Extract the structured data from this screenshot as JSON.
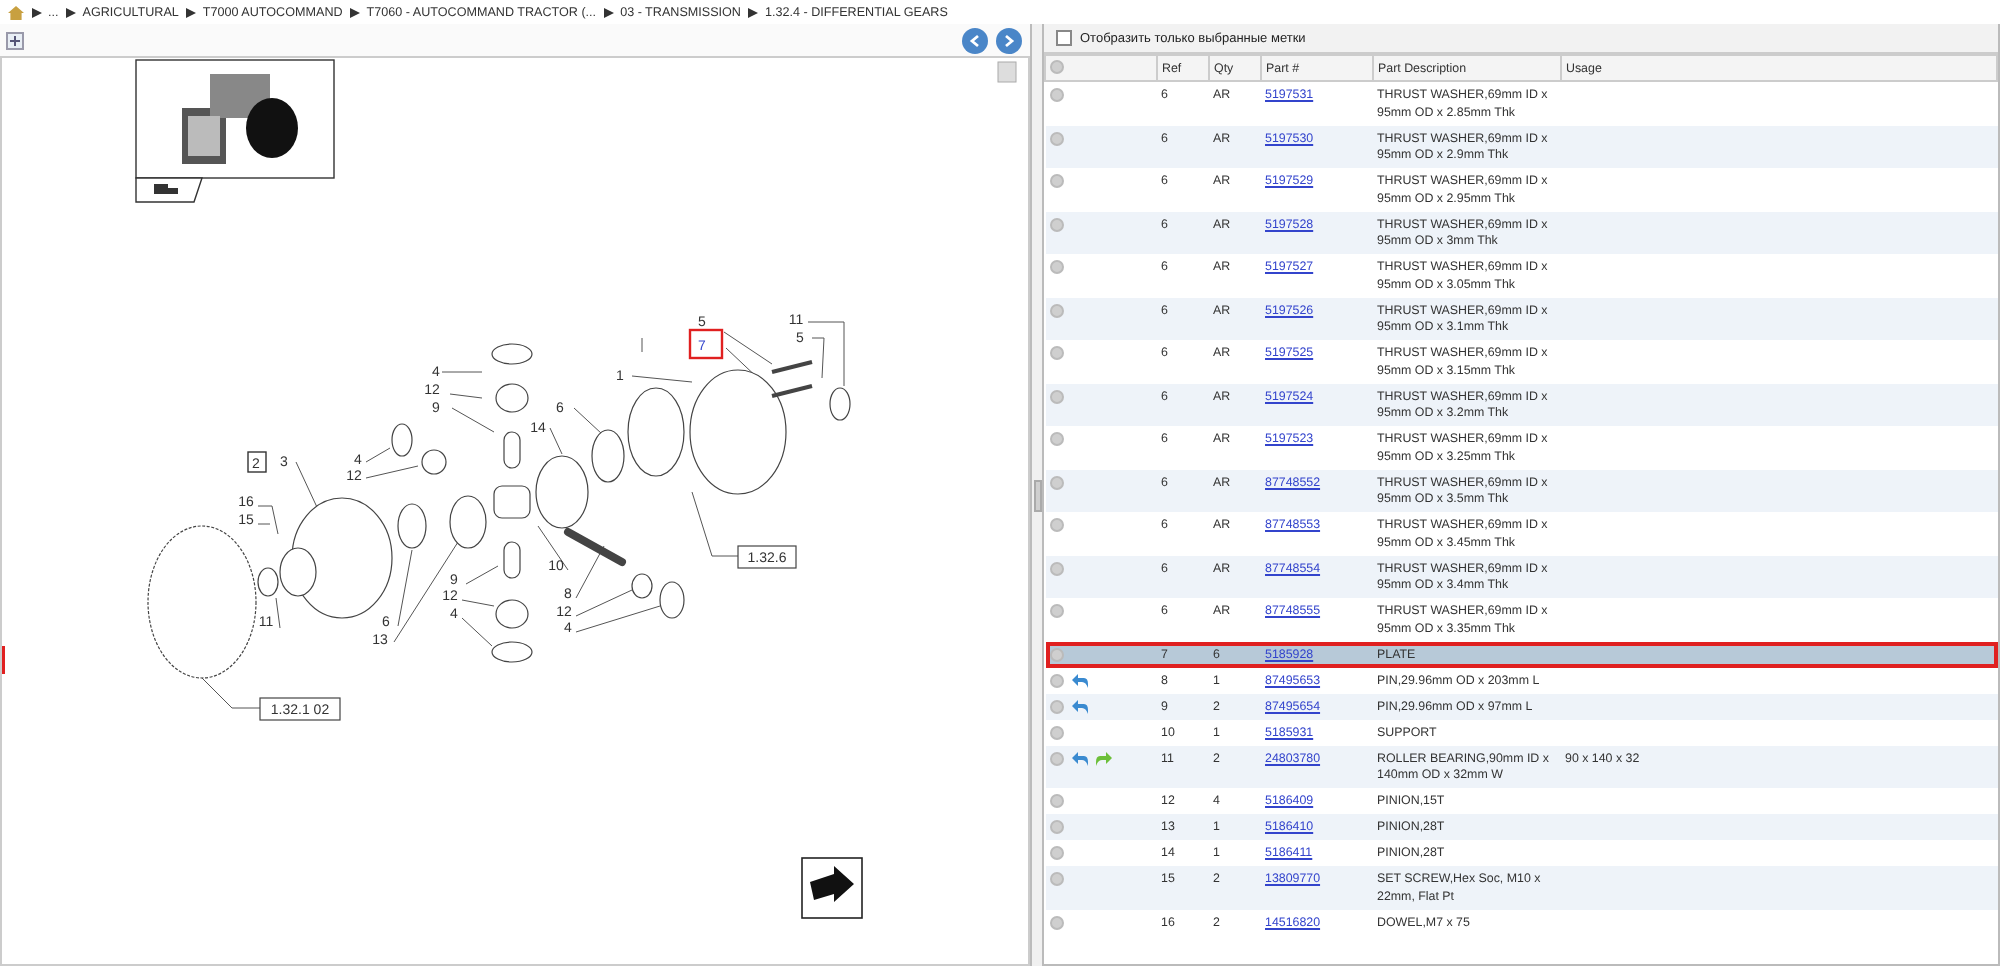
{
  "breadcrumb": [
    {
      "label": "..."
    },
    {
      "label": "AGRICULTURAL"
    },
    {
      "label": "T7000 AUTOCOMMAND"
    },
    {
      "label": "T7060 - AUTOCOMMAND TRACTOR (..."
    },
    {
      "label": "03 - TRANSMISSION"
    },
    {
      "label": "1.32.4 - DIFFERENTIAL GEARS"
    }
  ],
  "diagram": {
    "callouts": [
      {
        "text": "5",
        "kind": "number",
        "selected": false
      },
      {
        "text": "11",
        "kind": "number",
        "selected": false
      },
      {
        "text": "5",
        "kind": "number",
        "selected": false
      },
      {
        "text": "7",
        "kind": "number",
        "selected": true
      },
      {
        "text": "4",
        "kind": "number",
        "selected": false
      },
      {
        "text": "1",
        "kind": "number",
        "selected": false
      },
      {
        "text": "12",
        "kind": "number",
        "selected": false
      },
      {
        "text": "9",
        "kind": "number",
        "selected": false
      },
      {
        "text": "6",
        "kind": "number",
        "selected": false
      },
      {
        "text": "14",
        "kind": "number",
        "selected": false
      },
      {
        "text": "2",
        "kind": "boxed",
        "selected": false
      },
      {
        "text": "3",
        "kind": "number",
        "selected": false
      },
      {
        "text": "4",
        "kind": "number",
        "selected": false
      },
      {
        "text": "12",
        "kind": "number",
        "selected": false
      },
      {
        "text": "16",
        "kind": "number",
        "selected": false
      },
      {
        "text": "15",
        "kind": "number",
        "selected": false
      },
      {
        "text": "10",
        "kind": "number",
        "selected": false
      },
      {
        "text": "9",
        "kind": "number",
        "selected": false
      },
      {
        "text": "8",
        "kind": "number",
        "selected": false
      },
      {
        "text": "12",
        "kind": "number",
        "selected": false
      },
      {
        "text": "12",
        "kind": "number",
        "selected": false
      },
      {
        "text": "4",
        "kind": "number",
        "selected": false
      },
      {
        "text": "11",
        "kind": "number",
        "selected": false
      },
      {
        "text": "6",
        "kind": "number",
        "selected": false
      },
      {
        "text": "4",
        "kind": "number",
        "selected": false
      },
      {
        "text": "13",
        "kind": "number",
        "selected": false
      }
    ],
    "references": [
      {
        "text": "1.32.6"
      },
      {
        "text": "1.32.1 02"
      }
    ]
  },
  "filter": {
    "label": "Отобразить только выбранные метки",
    "checked": false
  },
  "table": {
    "columns": [
      "Ref",
      "Qty",
      "Part #",
      "Part Description",
      "Usage"
    ],
    "rows": [
      {
        "ref": "6",
        "qty": "AR",
        "part": "5197531",
        "description": "THRUST WASHER,69mm ID x 95mm OD x 2.85mm Thk",
        "back_arrow": false,
        "forward_arrow": false,
        "selected": false
      },
      {
        "ref": "6",
        "qty": "AR",
        "part": "5197530",
        "description": "THRUST WASHER,69mm ID x 95mm OD x 2.9mm Thk",
        "back_arrow": false,
        "forward_arrow": false,
        "selected": false
      },
      {
        "ref": "6",
        "qty": "AR",
        "part": "5197529",
        "description": "THRUST WASHER,69mm ID x 95mm OD x 2.95mm Thk",
        "back_arrow": false,
        "forward_arrow": false,
        "selected": false
      },
      {
        "ref": "6",
        "qty": "AR",
        "part": "5197528",
        "description": "THRUST WASHER,69mm ID x 95mm OD x 3mm Thk",
        "back_arrow": false,
        "forward_arrow": false,
        "selected": false
      },
      {
        "ref": "6",
        "qty": "AR",
        "part": "5197527",
        "description": "THRUST WASHER,69mm ID x 95mm OD x 3.05mm Thk",
        "back_arrow": false,
        "forward_arrow": false,
        "selected": false
      },
      {
        "ref": "6",
        "qty": "AR",
        "part": "5197526",
        "description": "THRUST WASHER,69mm ID x 95mm OD x 3.1mm Thk",
        "back_arrow": false,
        "forward_arrow": false,
        "selected": false
      },
      {
        "ref": "6",
        "qty": "AR",
        "part": "5197525",
        "description": "THRUST WASHER,69mm ID x 95mm OD x 3.15mm Thk",
        "back_arrow": false,
        "forward_arrow": false,
        "selected": false
      },
      {
        "ref": "6",
        "qty": "AR",
        "part": "5197524",
        "description": "THRUST WASHER,69mm ID x 95mm OD x 3.2mm Thk",
        "back_arrow": false,
        "forward_arrow": false,
        "selected": false
      },
      {
        "ref": "6",
        "qty": "AR",
        "part": "5197523",
        "description": "THRUST WASHER,69mm ID x 95mm OD x 3.25mm Thk",
        "back_arrow": false,
        "forward_arrow": false,
        "selected": false
      },
      {
        "ref": "6",
        "qty": "AR",
        "part": "87748552",
        "description": "THRUST WASHER,69mm ID x 95mm OD x 3.5mm Thk",
        "back_arrow": false,
        "forward_arrow": false,
        "selected": false
      },
      {
        "ref": "6",
        "qty": "AR",
        "part": "87748553",
        "description": "THRUST WASHER,69mm ID x 95mm OD x 3.45mm Thk",
        "back_arrow": false,
        "forward_arrow": false,
        "selected": false
      },
      {
        "ref": "6",
        "qty": "AR",
        "part": "87748554",
        "description": "THRUST WASHER,69mm ID x 95mm OD x 3.4mm Thk",
        "back_arrow": false,
        "forward_arrow": false,
        "selected": false
      },
      {
        "ref": "6",
        "qty": "AR",
        "part": "87748555",
        "description": "THRUST WASHER,69mm ID x 95mm OD x 3.35mm Thk",
        "back_arrow": false,
        "forward_arrow": false,
        "selected": false
      },
      {
        "ref": "7",
        "qty": "6",
        "part": "5185928",
        "description": "PLATE",
        "back_arrow": false,
        "forward_arrow": false,
        "selected": true
      },
      {
        "ref": "8",
        "qty": "1",
        "part": "87495653",
        "description": "PIN,29.96mm OD x 203mm L",
        "back_arrow": true,
        "forward_arrow": false,
        "selected": false
      },
      {
        "ref": "9",
        "qty": "2",
        "part": "87495654",
        "description": "PIN,29.96mm OD x 97mm L",
        "back_arrow": true,
        "forward_arrow": false,
        "selected": false
      },
      {
        "ref": "10",
        "qty": "1",
        "part": "5185931",
        "description": "SUPPORT",
        "back_arrow": false,
        "forward_arrow": false,
        "selected": false
      },
      {
        "ref": "11",
        "qty": "2",
        "part": "24803780",
        "description": "ROLLER BEARING,90mm ID x 140mm OD x 32mm W",
        "usage": "90 x 140 x 32",
        "back_arrow": true,
        "forward_arrow": true,
        "selected": false
      },
      {
        "ref": "12",
        "qty": "4",
        "part": "5186409",
        "description": "PINION,15T",
        "back_arrow": false,
        "forward_arrow": false,
        "selected": false
      },
      {
        "ref": "13",
        "qty": "1",
        "part": "5186410",
        "description": "PINION,28T",
        "back_arrow": false,
        "forward_arrow": false,
        "selected": false
      },
      {
        "ref": "14",
        "qty": "1",
        "part": "5186411",
        "description": "PINION,28T",
        "back_arrow": false,
        "forward_arrow": false,
        "selected": false
      },
      {
        "ref": "15",
        "qty": "2",
        "part": "13809770",
        "description": "SET SCREW,Hex Soc, M10 x 22mm, Flat Pt",
        "back_arrow": false,
        "forward_arrow": false,
        "selected": false
      },
      {
        "ref": "16",
        "qty": "2",
        "part": "14516820",
        "description": "DOWEL,M7 x 75",
        "back_arrow": false,
        "forward_arrow": false,
        "selected": false
      }
    ]
  }
}
